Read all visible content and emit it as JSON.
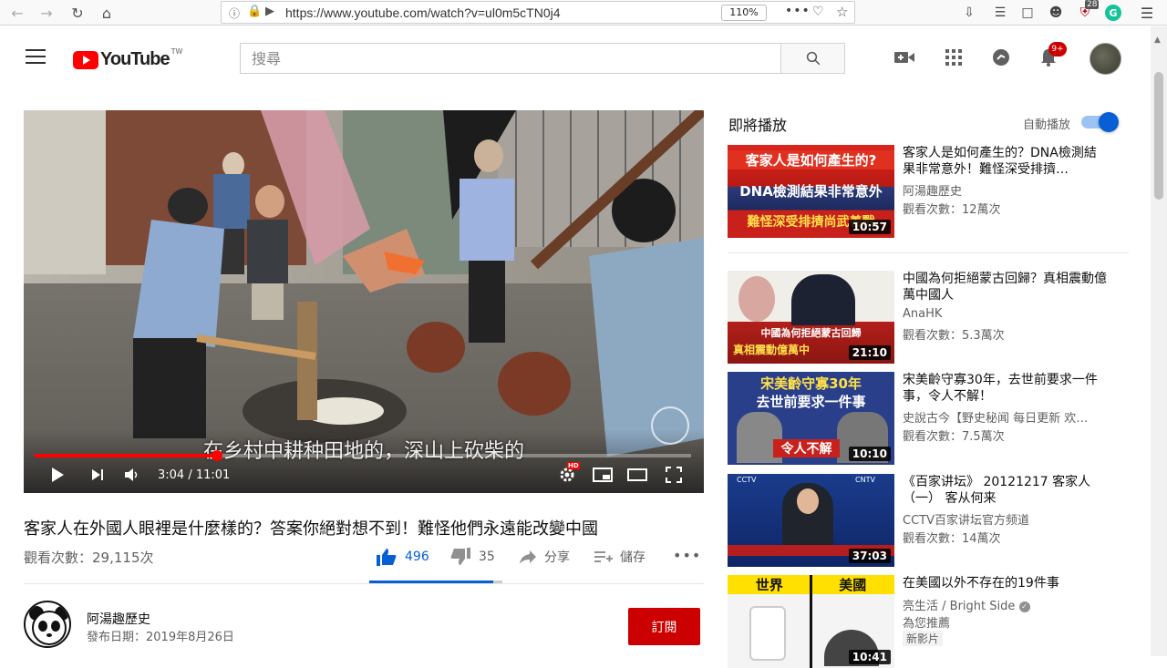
{
  "browser": {
    "url": "https://www.youtube.com/watch?v=ul0m5cTN0j4",
    "zoom": "110%",
    "ext_badge": "28"
  },
  "header": {
    "logo_text": "YouTube",
    "logo_region": "TW",
    "search_placeholder": "搜尋",
    "notification_count": "9+"
  },
  "player": {
    "subtitle": "在乡村中耕种田地的，深山上砍柴的",
    "time": "3:04 / 11:01",
    "progress": 0.278,
    "quality_badge": "HD"
  },
  "video": {
    "title": "客家人在外國人眼裡是什麼樣的？答案你絕對想不到！難怪他們永遠能改變中國",
    "views": "觀看次數：29,115次",
    "likes": "496",
    "dislikes": "35",
    "share_label": "分享",
    "save_label": "儲存",
    "like_ratio": 0.934
  },
  "channel": {
    "name": "阿湯趣歷史",
    "published": "發布日期：2019年8月26日",
    "subscribe_label": "訂閱"
  },
  "sidebar": {
    "up_next_label": "即將播放",
    "autoplay_label": "自動播放",
    "items": [
      {
        "title": "客家人是如何產生的？DNA檢測結果非常意外！難怪深受排擠…",
        "channel": "阿湯趣歷史",
        "views": "觀看次數：12萬次",
        "duration": "10:57",
        "thumb_lines": [
          "客家人是如何產生的?",
          "DNA檢測結果非常意外",
          "難怪深受排擠尚武善戰"
        ]
      },
      {
        "title": "中國為何拒絕蒙古回歸？真相震動億萬中國人",
        "channel": "AnaHK",
        "views": "觀看次數：5.3萬次",
        "duration": "21:10",
        "thumb_lines": [
          "中國為何拒絕蒙古回歸",
          "真相震動億萬中"
        ]
      },
      {
        "title": "宋美齡守寡30年，去世前要求一件事，令人不解！",
        "channel": "史說古今【野史秘闻 每日更新 欢…",
        "views": "觀看次數：7.5萬次",
        "duration": "10:10",
        "thumb_lines": [
          "宋美齡守寡30年",
          "去世前要求一件事",
          "令人不解"
        ]
      },
      {
        "title": "《百家讲坛》 20121217 客家人（一） 客从何来",
        "channel": "CCTV百家讲坛官方频道",
        "views": "觀看次數：14萬次",
        "duration": "37:03",
        "thumb_lines": [
          "CCTV",
          "CNTV"
        ]
      },
      {
        "title": "在美國以外不存在的19件事",
        "channel": "亮生活 / Bright Side",
        "views": "為您推薦",
        "badge": "新影片",
        "duration": "10:41",
        "thumb_lines": [
          "世界",
          "美國"
        ]
      }
    ]
  }
}
